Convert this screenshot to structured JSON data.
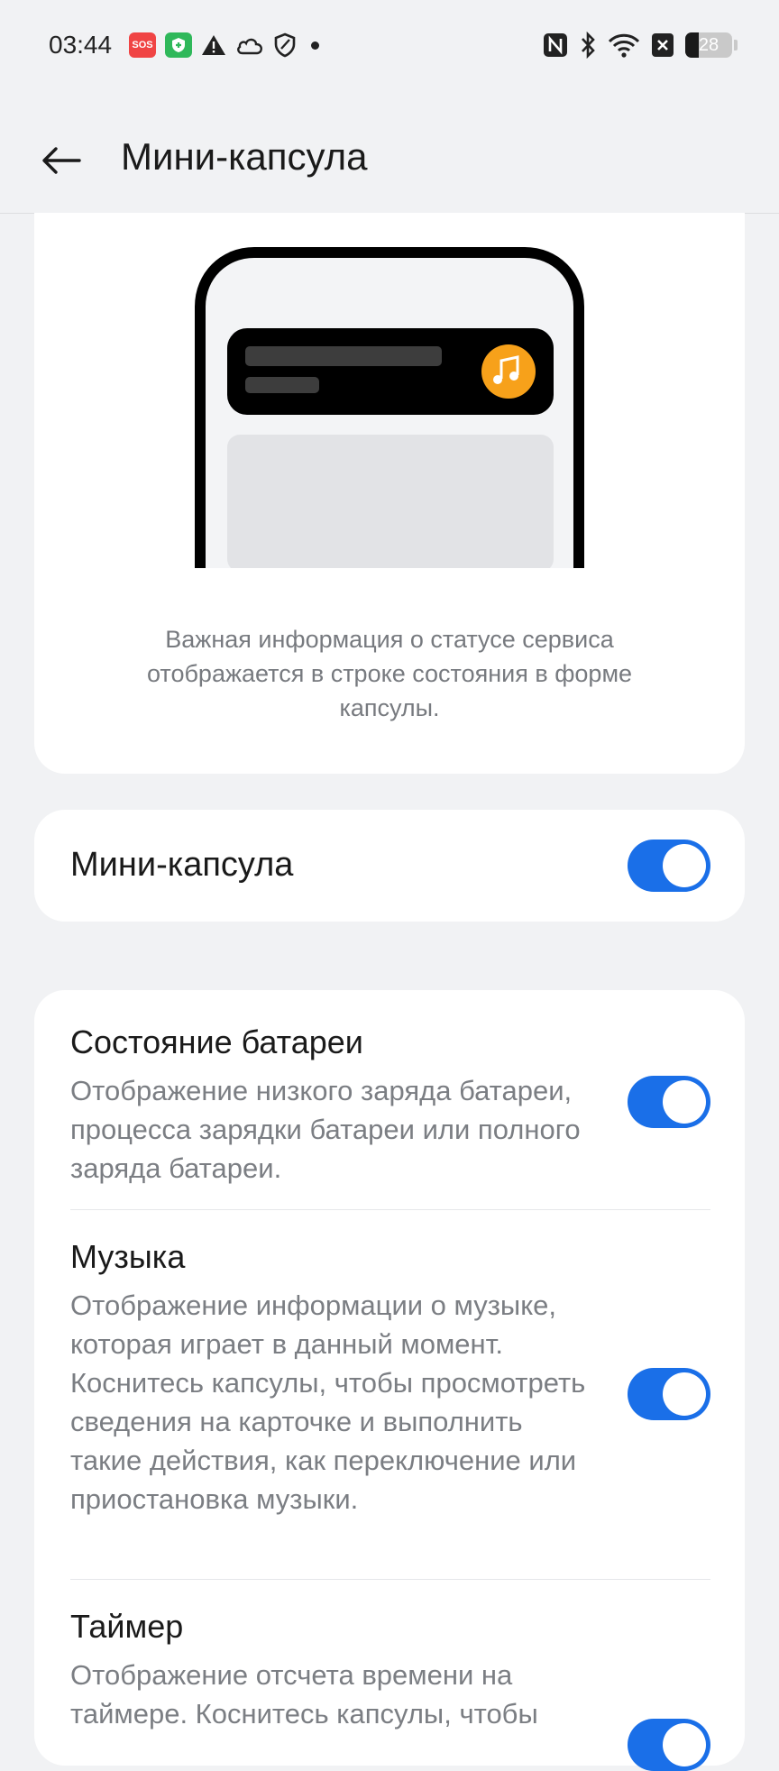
{
  "status_bar": {
    "time": "03:44",
    "sos_label": "SOS",
    "battery_level": "28",
    "left_icons": [
      "sos-icon",
      "shield-plus-icon",
      "warning-icon",
      "cloud-icon",
      "shield-outline-icon",
      "dot-icon"
    ],
    "right_icons": [
      "nfc-icon",
      "bluetooth-icon",
      "wifi-icon",
      "close-box-icon",
      "battery-icon"
    ]
  },
  "header": {
    "title": "Мини-капсула",
    "back_icon": "back-arrow-icon"
  },
  "illustration": {
    "capsule_icon": "music-note-icon",
    "accent_color": "#f7a11a",
    "description": "Важная информация о статусе сервиса отображается в строке состояния в форме капсулы."
  },
  "main_toggle": {
    "label": "Мини-капсула",
    "enabled": true
  },
  "options": [
    {
      "title": "Состояние батареи",
      "description": "Отображение низкого заряда батареи, процесса зарядки батареи или полного заряда батареи.",
      "enabled": true
    },
    {
      "title": "Музыка",
      "description": "Отображение информации о музыке, которая играет в данный момент. Коснитесь капсулы, чтобы просмотреть сведения на карточке и выполнить такие действия, как переключение или приостановка музыки.",
      "enabled": true
    },
    {
      "title": "Таймер",
      "description": "Отображение отсчета времени на таймере. Коснитесь капсулы, чтобы",
      "enabled": true
    }
  ],
  "colors": {
    "switch_on": "#1a6fe8",
    "background": "#f1f2f4",
    "card": "#ffffff"
  }
}
